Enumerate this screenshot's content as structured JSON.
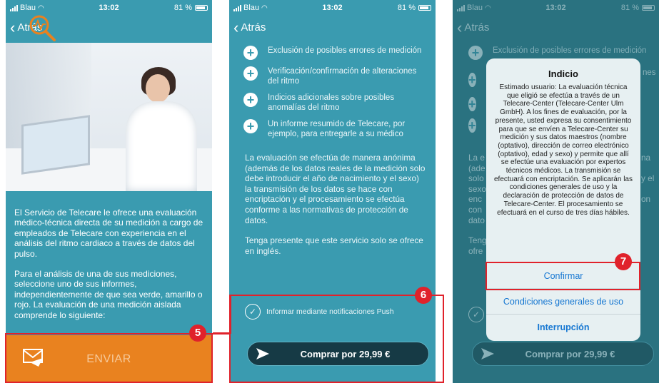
{
  "status": {
    "carrier": "Blau",
    "time": "13:02",
    "battery": "81 %"
  },
  "back_label": "Atrás",
  "screen1": {
    "paragraph1": "El Servicio de Telecare le ofrece una evaluación médico-técnica directa de su medición a cargo de empleados de Telecare con experiencia en el análisis del ritmo cardiaco a través de datos del pulso.",
    "paragraph2": "Para el análisis de una de sus mediciones, seleccione uno de sus informes, independientemente de que sea verde, amarillo o rojo. La evaluación de una medición aislada comprende lo siguiente:",
    "send_label": "ENVIAR",
    "callout": "5"
  },
  "screen2": {
    "features": [
      "Exclusión de posibles errores de medición",
      "Verificación/confirmación de alteraciones del ritmo",
      "Indicios adicionales sobre posibles anomalías del ritmo",
      "Un informe resumido de Telecare, por ejemplo, para entregarle a su médico"
    ],
    "paragraph1": "La evaluación se efectúa de manera anónima (además de los datos reales de la medición solo debe introducir el año de nacimiento y el sexo) la transmisión de los datos se hace con encriptación y el procesamiento se efectúa conforme a las normativas de protección de datos.",
    "paragraph2": "Tenga presente que este servicio solo se ofrece en inglés.",
    "push_label": "Informar mediante notificaciones Push",
    "buy_label": "Comprar por 29,99 €",
    "callout": "6"
  },
  "screen3": {
    "bg_feature": "Exclusión de posibles errores de medición",
    "alert_title": "Indicio",
    "alert_message": "Estimado usuario: La evaluación técnica que eligió se efectúa a través de un Telecare-Center (Telecare-Center Ulm GmbH). A los fines de evaluación, por la presente, usted expresa su consentimiento para que se envíen a Telecare-Center su medición y sus datos maestros (nombre (optativo), dirección de correo electrónico (optativo), edad y sexo) y permite que allí se efectúe una evaluación por expertos técnicos médicos. La transmisión se efectuará con encriptación. Se aplicarán las condiciones generales de uso y la declaración de protección de datos de Telecare-Center. El procesamiento se efectuará en el curso de tres días hábiles.",
    "confirm_label": "Confirmar",
    "conditions_label": "Condiciones generales de uso",
    "interrupt_label": "Interrupción",
    "buy_label": "Comprar por 29,99 €",
    "callout": "7",
    "frag_left": [
      "La e",
      "(ade",
      "solo",
      "sexo",
      "enc",
      "con",
      "dato"
    ],
    "frag_right_a": [
      "nes"
    ],
    "frag_right_b": [
      "na",
      "y el",
      "on"
    ],
    "frag_bottom": [
      "Teng",
      "ofre"
    ]
  },
  "colors": {
    "teal": "#3a9bb0",
    "orange": "#e9821f",
    "callout_red": "#e0222b",
    "alert_link": "#1677d2"
  }
}
